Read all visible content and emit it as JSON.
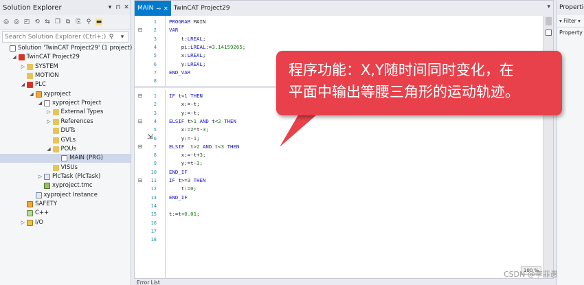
{
  "solution_explorer": {
    "title": "Solution Explorer",
    "title_buttons": [
      "▾",
      "⊓",
      "✕"
    ],
    "toolbar_icons": [
      "◎",
      "◎",
      "◰",
      "⟲",
      "⇆",
      "❐",
      "⧉",
      "⎘",
      "⚲",
      "▬"
    ],
    "search_placeholder": "Search Solution Explorer (Ctrl+;)",
    "search_icon": "⚲",
    "search_dropdown": "▾",
    "tree": [
      {
        "label": "Solution 'TwinCAT Project29' (1 project)",
        "level": 0,
        "arrow": "",
        "icon": "i-sol",
        "selected": false
      },
      {
        "label": "TwinCAT Project29",
        "level": 1,
        "arrow": "◢",
        "icon": "i-proj",
        "selected": false
      },
      {
        "label": "SYSTEM",
        "level": 2,
        "arrow": "▷",
        "icon": "i-folder",
        "selected": false
      },
      {
        "label": "MOTION",
        "level": 2,
        "arrow": "",
        "icon": "i-folder",
        "selected": false
      },
      {
        "label": "PLC",
        "level": 2,
        "arrow": "◢",
        "icon": "i-proj",
        "selected": false
      },
      {
        "label": "xyproject",
        "level": 3,
        "arrow": "◢",
        "icon": "i-plc",
        "selected": false
      },
      {
        "label": "xyproject Project",
        "level": 4,
        "arrow": "◢",
        "icon": "i-file",
        "selected": false
      },
      {
        "label": "External Types",
        "level": 5,
        "arrow": "▷",
        "icon": "i-folder",
        "selected": false
      },
      {
        "label": "References",
        "level": 5,
        "arrow": "▷",
        "icon": "i-folder",
        "selected": false
      },
      {
        "label": "DUTs",
        "level": 5,
        "arrow": "",
        "icon": "i-folder",
        "selected": false
      },
      {
        "label": "GVLs",
        "level": 5,
        "arrow": "",
        "icon": "i-folder",
        "selected": false
      },
      {
        "label": "POUs",
        "level": 5,
        "arrow": "◢",
        "icon": "i-folder",
        "selected": false
      },
      {
        "label": "MAIN (PRG)",
        "level": 6,
        "arrow": "",
        "icon": "i-file",
        "selected": true
      },
      {
        "label": "VISUs",
        "level": 5,
        "arrow": "",
        "icon": "i-folder",
        "selected": false
      },
      {
        "label": "PlcTask (PlcTask)",
        "level": 4,
        "arrow": "▷",
        "icon": "i-task",
        "selected": false
      },
      {
        "label": "xyproject.tmc",
        "level": 4,
        "arrow": "",
        "icon": "i-tmc",
        "selected": false
      },
      {
        "label": "xyproject Instance",
        "level": 3,
        "arrow": "",
        "icon": "i-task",
        "selected": false
      },
      {
        "label": "SAFETY",
        "level": 2,
        "arrow": "",
        "icon": "i-plc",
        "selected": false
      },
      {
        "label": "C++",
        "level": 2,
        "arrow": "",
        "icon": "i-cpp",
        "selected": false
      },
      {
        "label": "I/O",
        "level": 2,
        "arrow": "▷",
        "icon": "i-io",
        "selected": false
      }
    ]
  },
  "editor": {
    "tabs": [
      {
        "label": "MAIN",
        "active": true,
        "pin": "⊸",
        "close": "✕"
      },
      {
        "label": "TwinCAT Project29",
        "active": false
      }
    ],
    "tab_dropdown": "▾",
    "declaration": [
      {
        "n": "1",
        "fold": "",
        "tokens": [
          [
            "kw",
            "PROGRAM "
          ],
          [
            "id",
            "MAIN"
          ]
        ]
      },
      {
        "n": "2",
        "fold": "⊟",
        "tokens": [
          [
            "kw",
            "VAR"
          ]
        ]
      },
      {
        "n": "3",
        "fold": "",
        "tokens": [
          [
            "id",
            "    t"
          ],
          [
            "op",
            ":"
          ],
          [
            "ty",
            "LREAL"
          ],
          [
            "op",
            ";"
          ]
        ]
      },
      {
        "n": "4",
        "fold": "",
        "tokens": [
          [
            "id",
            "    pi"
          ],
          [
            "op",
            ":"
          ],
          [
            "ty",
            "LREAL"
          ],
          [
            "op",
            ":="
          ],
          [
            "num",
            "3.14159265"
          ],
          [
            "op",
            ";"
          ]
        ]
      },
      {
        "n": "5",
        "fold": "",
        "tokens": [
          [
            "id",
            "    x"
          ],
          [
            "op",
            ":"
          ],
          [
            "ty",
            "LREAL"
          ],
          [
            "op",
            ";"
          ]
        ]
      },
      {
        "n": "6",
        "fold": "",
        "tokens": [
          [
            "id",
            "    y"
          ],
          [
            "op",
            ":"
          ],
          [
            "ty",
            "LREAL"
          ],
          [
            "op",
            ";"
          ]
        ]
      },
      {
        "n": "7",
        "fold": "",
        "tokens": [
          [
            "kw",
            "END_VAR"
          ]
        ]
      },
      {
        "n": "8",
        "fold": "",
        "tokens": []
      }
    ],
    "implementation": [
      {
        "n": "1",
        "fold": "⊟",
        "tokens": [
          [
            "kw",
            "IF "
          ],
          [
            "id",
            "t"
          ],
          [
            "op",
            "<"
          ],
          [
            "num",
            "1"
          ],
          [
            "kw",
            " THEN"
          ]
        ]
      },
      {
        "n": "2",
        "fold": "",
        "tokens": [
          [
            "id",
            "    x"
          ],
          [
            "op",
            ":=-"
          ],
          [
            "id",
            "t"
          ],
          [
            "op",
            ";"
          ]
        ]
      },
      {
        "n": "3",
        "fold": "",
        "tokens": [
          [
            "id",
            "    y"
          ],
          [
            "op",
            ":=-"
          ],
          [
            "id",
            "t"
          ],
          [
            "op",
            ";"
          ]
        ]
      },
      {
        "n": "4",
        "fold": "⊟",
        "tokens": [
          [
            "kw",
            "ELSIF "
          ],
          [
            "id",
            "t"
          ],
          [
            "op",
            ">"
          ],
          [
            "num",
            "1"
          ],
          [
            "kw",
            " AND "
          ],
          [
            "id",
            "t"
          ],
          [
            "op",
            "<"
          ],
          [
            "num",
            "2"
          ],
          [
            "kw",
            " THEN"
          ]
        ]
      },
      {
        "n": "5",
        "fold": "",
        "tokens": [
          [
            "id",
            "    x"
          ],
          [
            "op",
            ":="
          ],
          [
            "num",
            "2"
          ],
          [
            "op",
            "*"
          ],
          [
            "id",
            "t"
          ],
          [
            "op",
            "-"
          ],
          [
            "num",
            "3"
          ],
          [
            "op",
            ";"
          ]
        ]
      },
      {
        "n": "6",
        "fold": "",
        "tokens": [
          [
            "id",
            "    y"
          ],
          [
            "op",
            ":=-"
          ],
          [
            "num",
            "1"
          ],
          [
            "op",
            ";"
          ]
        ]
      },
      {
        "n": "7",
        "fold": "⊟",
        "tokens": [
          [
            "kw",
            "ELSIF  "
          ],
          [
            "id",
            "t"
          ],
          [
            "op",
            ">"
          ],
          [
            "num",
            "2"
          ],
          [
            "kw",
            " AND "
          ],
          [
            "id",
            "t"
          ],
          [
            "op",
            "<"
          ],
          [
            "num",
            "3"
          ],
          [
            "kw",
            " THEN"
          ]
        ]
      },
      {
        "n": "8",
        "fold": "",
        "tokens": [
          [
            "id",
            "    x"
          ],
          [
            "op",
            ":=-"
          ],
          [
            "id",
            "t"
          ],
          [
            "op",
            "+"
          ],
          [
            "num",
            "3"
          ],
          [
            "op",
            ";"
          ]
        ]
      },
      {
        "n": "9",
        "fold": "",
        "tokens": [
          [
            "id",
            "    y"
          ],
          [
            "op",
            ":="
          ],
          [
            "id",
            "t"
          ],
          [
            "op",
            "-"
          ],
          [
            "num",
            "3"
          ],
          [
            "op",
            ";"
          ]
        ]
      },
      {
        "n": "10",
        "fold": "",
        "tokens": [
          [
            "kw",
            "END_IF"
          ]
        ]
      },
      {
        "n": "11",
        "fold": "⊟",
        "tokens": [
          [
            "kw",
            "IF "
          ],
          [
            "id",
            "t"
          ],
          [
            "op",
            ">="
          ],
          [
            "num",
            "3"
          ],
          [
            "kw",
            " THEN"
          ]
        ]
      },
      {
        "n": "12",
        "fold": "",
        "tokens": [
          [
            "id",
            "    t"
          ],
          [
            "op",
            ":="
          ],
          [
            "num",
            "0"
          ],
          [
            "op",
            ";"
          ]
        ]
      },
      {
        "n": "13",
        "fold": "",
        "tokens": [
          [
            "kw",
            "END_IF"
          ]
        ]
      },
      {
        "n": "14",
        "fold": "",
        "tokens": []
      },
      {
        "n": "15",
        "fold": "",
        "tokens": [
          [
            "id",
            "t"
          ],
          [
            "op",
            ":="
          ],
          [
            "id",
            "t"
          ],
          [
            "op",
            "+"
          ],
          [
            "num",
            "0.01"
          ],
          [
            "op",
            ";"
          ]
        ]
      },
      {
        "n": "16",
        "fold": "",
        "tokens": []
      },
      {
        "n": "17",
        "fold": "",
        "tokens": []
      },
      {
        "n": "18",
        "fold": "",
        "tokens": []
      }
    ]
  },
  "properties": {
    "title": "Properties",
    "filter": "▾ Filter ▾",
    "label": "Property"
  },
  "bottom": {
    "error_list": "Error List",
    "zoom": "100 %",
    "watermark": "CSDN @李菲愚"
  },
  "callout": {
    "line1": "程序功能：X,Y随时间同时变化，在",
    "line2": "平面中输出等腰三角形的运动轨迹。",
    "color": "#e8414b"
  }
}
